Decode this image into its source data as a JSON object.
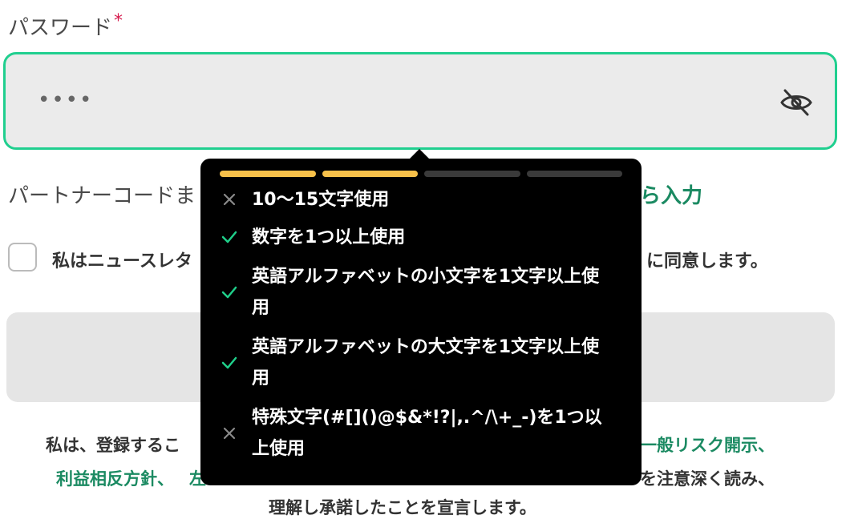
{
  "password_label": "パスワード",
  "required_mark": "*",
  "password_masked": "••••",
  "partner_text_start": "パートナーコードま",
  "partner_link_tail": "ら入力",
  "newsletter_start": "私はニュースレタ",
  "newsletter_end": "に同意します。",
  "footer": {
    "line1_start": "私は、登録するこ",
    "line1_link": "一般リスク開示、",
    "line2_link1": "利益相反方針、",
    "line2_link2": "左",
    "line2_end": "を注意深く読み、",
    "line3": "理解し承諾したことを宣言します。"
  },
  "strength": {
    "filled_segments": 2,
    "total_segments": 4
  },
  "colors": {
    "accent": "#20cf8f",
    "link": "#1b8a62",
    "strength_bar": "#f8c14a",
    "check": "#1fcf8a"
  },
  "rules": [
    {
      "text": "10〜15文字使用",
      "met": false
    },
    {
      "text": "数字を1つ以上使用",
      "met": true
    },
    {
      "text": "英語アルファベットの小文字を1文字以上使用",
      "met": true
    },
    {
      "text": "英語アルファベットの大文字を1文字以上使用",
      "met": true
    },
    {
      "text": "特殊文字(#[]()@$&*!?|,.^/\\+_-)を1つ以上使用",
      "met": false
    }
  ]
}
